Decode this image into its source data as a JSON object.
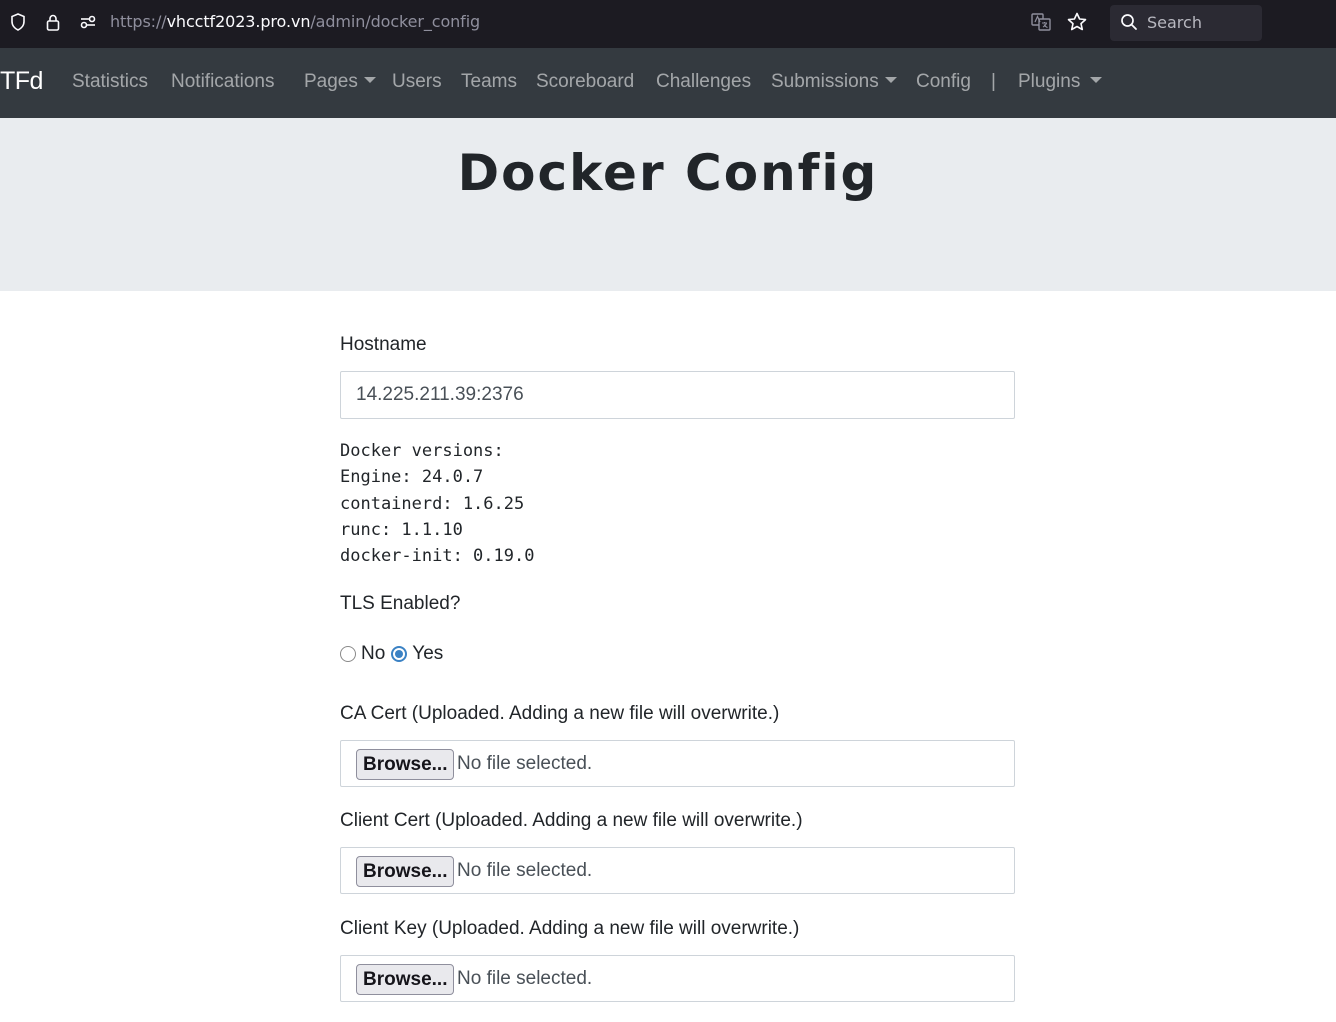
{
  "browser": {
    "url_prefix": "https://",
    "url_host": "vhcctf2023.pro.vn",
    "url_path": "/admin/docker_config",
    "search_label": "Search"
  },
  "navbar": {
    "brand": "TFd",
    "items": [
      {
        "label": "Statistics"
      },
      {
        "label": "Notifications"
      },
      {
        "label": "Pages"
      },
      {
        "label": "Users"
      },
      {
        "label": "Teams"
      },
      {
        "label": "Scoreboard"
      },
      {
        "label": "Challenges"
      },
      {
        "label": "Submissions"
      },
      {
        "label": "Config"
      },
      {
        "label": "|"
      },
      {
        "label": "Plugins"
      }
    ]
  },
  "page": {
    "title": "Docker Config"
  },
  "form": {
    "hostname_label": "Hostname",
    "hostname_value": "14.225.211.39:2376",
    "docker_versions": "Docker versions:\nEngine: 24.0.7\ncontainerd: 1.6.25\nrunc: 1.1.10\ndocker-init: 0.19.0",
    "tls_label": "TLS Enabled?",
    "tls_options": [
      {
        "label": "No",
        "checked": false
      },
      {
        "label": "Yes",
        "checked": true
      }
    ],
    "files": [
      {
        "label": "CA Cert (Uploaded. Adding a new file will overwrite.)",
        "button": "Browse...",
        "status": "No file selected."
      },
      {
        "label": "Client Cert (Uploaded. Adding a new file will overwrite.)",
        "button": "Browse...",
        "status": "No file selected."
      },
      {
        "label": "Client Key (Uploaded. Adding a new file will overwrite.)",
        "button": "Browse...",
        "status": "No file selected."
      }
    ]
  },
  "colors": {
    "browser_bg": "#1c1b22",
    "navbar_bg": "#343a40",
    "jumbotron_bg": "#e9ecef",
    "radio_accent": "#3b82c4"
  }
}
